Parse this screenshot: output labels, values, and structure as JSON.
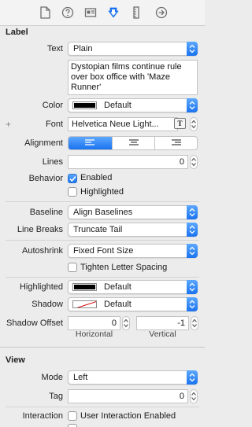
{
  "toolbar": {
    "icons": [
      "file-icon",
      "help-icon",
      "identity-icon",
      "attributes-icon",
      "size-ruler-icon",
      "connections-arrow-icon"
    ]
  },
  "label_section": {
    "title": "Label",
    "text_label": "Text",
    "text_type": "Plain",
    "text_value": "Dystopian films continue rule over box office with 'Maze Runner'",
    "color_label": "Color",
    "color_value": "Default",
    "font_label": "Font",
    "font_value": "Helvetica Neue Light...",
    "font_button": "T",
    "alignment_label": "Alignment",
    "lines_label": "Lines",
    "lines_value": "0",
    "behavior_label": "Behavior",
    "enabled_label": "Enabled",
    "highlighted_check_label": "Highlighted",
    "baseline_label": "Baseline",
    "baseline_value": "Align Baselines",
    "line_breaks_label": "Line Breaks",
    "line_breaks_value": "Truncate Tail",
    "autoshrink_label": "Autoshrink",
    "autoshrink_value": "Fixed Font Size",
    "tighten_label": "Tighten Letter Spacing",
    "highlighted_label": "Highlighted",
    "highlighted_value": "Default",
    "shadow_label": "Shadow",
    "shadow_value": "Default",
    "shadow_offset_label": "Shadow Offset",
    "shadow_offset_h": "0",
    "shadow_offset_v": "-1",
    "horizontal_label": "Horizontal",
    "vertical_label": "Vertical"
  },
  "view_section": {
    "title": "View",
    "mode_label": "Mode",
    "mode_value": "Left",
    "tag_label": "Tag",
    "tag_value": "0",
    "interaction_label": "Interaction",
    "user_interaction_label": "User Interaction Enabled"
  },
  "colors": {
    "accent": "#1a73f0",
    "swatch_black": "#000000"
  }
}
